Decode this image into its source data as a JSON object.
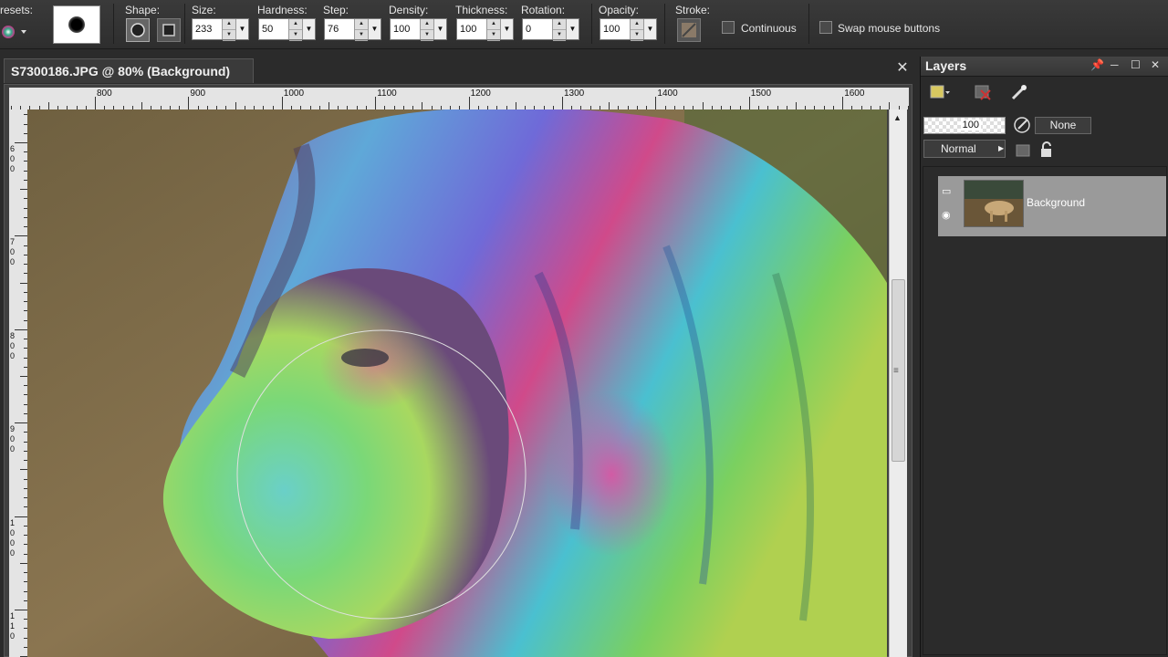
{
  "toolbar": {
    "presets_label": "resets:",
    "shape_label": "Shape:",
    "size_label": "Size:",
    "size_value": "233",
    "hardness_label": "Hardness:",
    "hardness_value": "50",
    "step_label": "Step:",
    "step_value": "76",
    "density_label": "Density:",
    "density_value": "100",
    "thickness_label": "Thickness:",
    "thickness_value": "100",
    "rotation_label": "Rotation:",
    "rotation_value": "0",
    "opacity_label": "Opacity:",
    "opacity_value": "100",
    "stroke_label": "Stroke:",
    "continuous_label": "Continuous",
    "continuous_checked": false,
    "swap_label": "Swap mouse buttons",
    "swap_checked": false
  },
  "document": {
    "tab_title": "S7300186.JPG @  80% (Background)",
    "close_glyph": "✕",
    "h_ruler_labels": [
      "800",
      "900",
      "1000",
      "1100",
      "1200",
      "1300",
      "1400",
      "1500",
      "1600"
    ],
    "v_ruler_labels": [
      [
        "6",
        "0",
        "0"
      ],
      [
        "7",
        "0",
        "0"
      ],
      [
        "8",
        "0",
        "0"
      ],
      [
        "9",
        "0",
        "0"
      ],
      [
        "1",
        "0",
        "0",
        "0"
      ],
      [
        "1",
        "1",
        "0"
      ]
    ]
  },
  "layers": {
    "title": "Layers",
    "opacity_value": "100",
    "blend_none": "None",
    "blend_mode": "Normal",
    "layer_name": "Background"
  },
  "colors": {
    "toolbar_bg": "#333333",
    "panel_bg": "#2a2a2a",
    "selected_layer": "#9a9a9a",
    "ruler_bg": "#e4e4e4"
  }
}
